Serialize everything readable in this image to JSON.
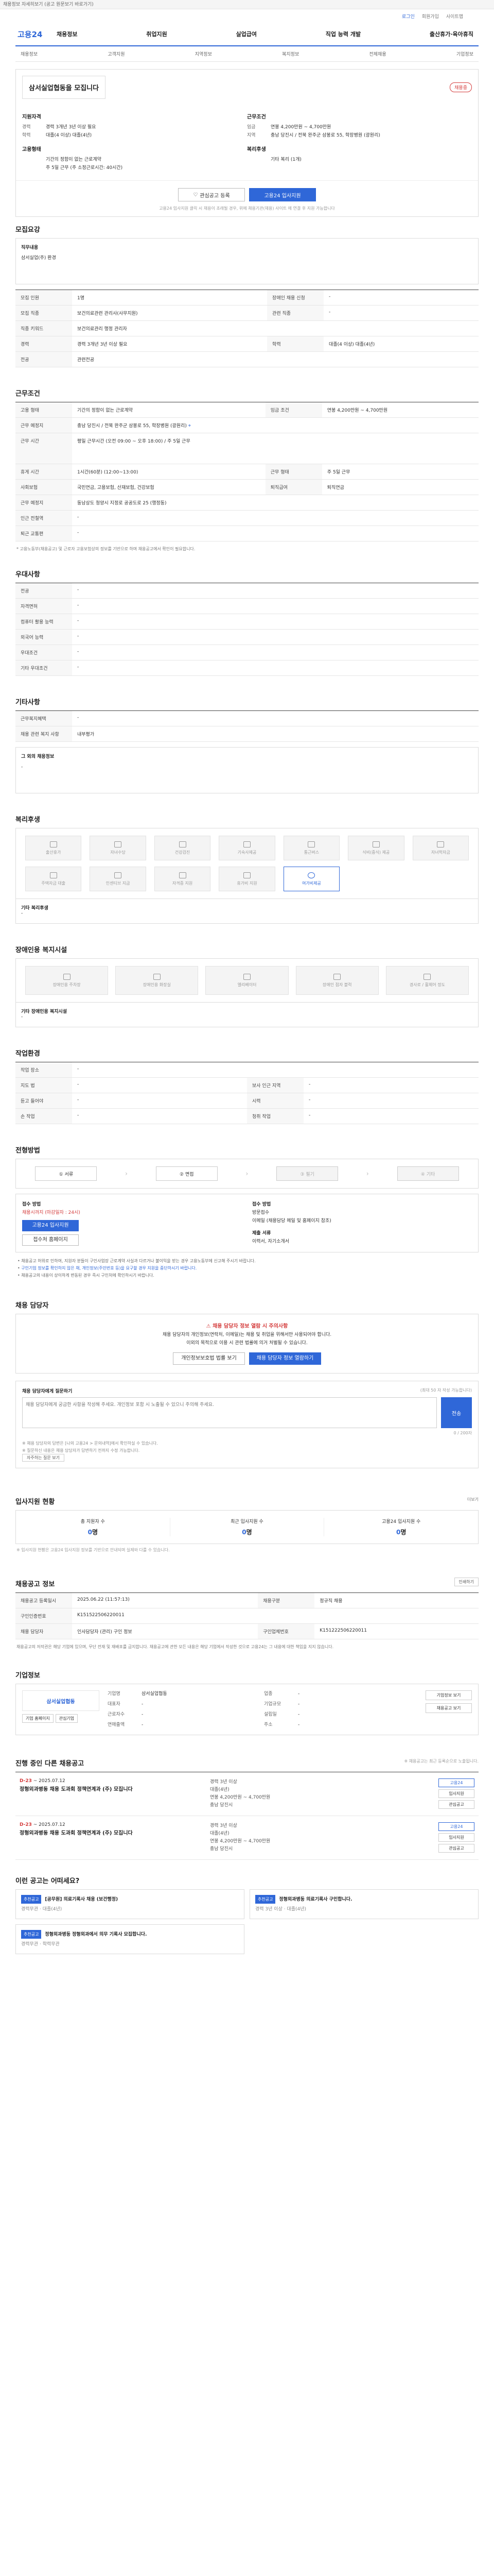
{
  "top_notice": "채용정보 자세히보기 (공고 원문보기 바로가기)",
  "util": {
    "login": "로그인",
    "join": "회원가입",
    "sitemap": "사이트맵"
  },
  "gnb": {
    "logo": "고용24",
    "menu": [
      "채용정보",
      "취업지원",
      "실업급여",
      "직업 능력 개발",
      "출산휴가·육아휴직"
    ]
  },
  "subnav": {
    "items": [
      "채용정보",
      "고객지원",
      "지역정보",
      "복지정보",
      "전체채용",
      "기업정보"
    ]
  },
  "summary": {
    "company": "삼서실업협동을 모집니다",
    "badge": "채용중",
    "left_title": "지원자격",
    "left": [
      {
        "k": "경력",
        "v": "경력 3개년 3년 이상 필요"
      },
      {
        "k": "학력",
        "v": "대졸(4 이상) 대졸(4년)"
      }
    ],
    "left2_title": "고용형태",
    "left2": [
      {
        "k": "",
        "v": "기간의 정함이 없는 근로계약"
      },
      {
        "k": "",
        "v": "주 5일 근무 (주 소정근로시간: 40시간)"
      }
    ],
    "right_title": "근무조건",
    "right": [
      {
        "k": "임금",
        "v": "연봉 4,200만원 ~ 4,700만원"
      },
      {
        "k": "지역",
        "v": "충남 당진시 / 전북 완주군 삼봉로 55, 학장병원 (광원리)"
      }
    ],
    "right2_title": "복리후생",
    "right2": [
      {
        "k": "",
        "v": "기타 복리 (1개)"
      }
    ],
    "actions": {
      "scrap": "관심공고 등록",
      "apply": "고용24 입사지원"
    },
    "note": "고용24 입사지원 클릭 시 채용이 초래될 경우, 위에 채용기관(채용) 사이트 에 연결 후 지원 가능합니다"
  },
  "recruit": {
    "title": "모집요강",
    "duty_title": "직무내용",
    "duty_text": "삼서실업(주) 환경",
    "rows": [
      {
        "k": "모집 인원",
        "v": "1명",
        "k2": "장애인 채용 신청",
        "v2": "-"
      },
      {
        "k": "모집 직종",
        "v": "보건의료관련 관리사(사무지원)",
        "k2": "관련 직종",
        "v2": "-"
      },
      {
        "k": "직종 키워드",
        "v": "보건의료관리 행정 관리자",
        "k2": "",
        "v2": ""
      },
      {
        "k": "경력",
        "v": "경력 3개년 3년 이상 필요",
        "k2": "학력",
        "v2": "대졸(4 이상) 대졸(4년)"
      },
      {
        "k": "전공",
        "v": "관련전공",
        "k2": "",
        "v2": ""
      }
    ]
  },
  "conditions": {
    "title": "근무조건",
    "rows": [
      {
        "k": "고용 형태",
        "v": "기간의 정함이 없는 근로계약",
        "k2": "임금 조건",
        "v2": "연봉 4,200만원 ~ 4,700만원"
      },
      {
        "k": "근무 예정지",
        "v": "충남 당진시 / 전북 완주군 삼봉로 55, 학장병원 (광원리)",
        "k2": "",
        "v2": ""
      },
      {
        "k": "근무 시간",
        "v": "평일 근무시간 (오전 09:00 ~ 오후 18:00) / 주 5일 근무",
        "k2": "",
        "v2": ""
      },
      {
        "k": "휴게 시간",
        "v": "1시간(60분) (12:00~13:00)",
        "k2": "근무 형태",
        "v2": "주 5일 근무"
      },
      {
        "k": "사회보험",
        "v": "국민연금, 고용보험, 산재보험, 건강보험",
        "k2": "퇴직급여",
        "v2": "퇴직연금"
      },
      {
        "k": "근무 예정지",
        "v": "동남상도 청양시 지정로 공공도로 25 (행정동)",
        "k2": "",
        "v2": ""
      },
      {
        "k": "인근 전철역",
        "v": "-",
        "k2": "",
        "v2": ""
      },
      {
        "k": "퇴근 교통편",
        "v": "-",
        "k2": "",
        "v2": ""
      }
    ],
    "note": "* 고용노동부(채용공고) 및 근로자 고용보험상의 정보를 기반으로 하며 채용공고에서 확인이 필요합니다."
  },
  "prefer": {
    "title": "우대사항",
    "rows": [
      {
        "k": "전공",
        "v": "-"
      },
      {
        "k": "자격면허",
        "v": "-"
      },
      {
        "k": "컴퓨터 활용 능력",
        "v": "-"
      },
      {
        "k": "외국어 능력",
        "v": "-"
      },
      {
        "k": "우대조건",
        "v": "-"
      },
      {
        "k": "기타 우대조건",
        "v": "-"
      }
    ]
  },
  "etc": {
    "title": "기타사항",
    "rows": [
      {
        "k": "근무복지혜택",
        "v": "-"
      },
      {
        "k": "채용 관련 복지 사항",
        "v": "내부평가"
      }
    ],
    "text_title": "그 외의 채용정보",
    "text": "-"
  },
  "welfare": {
    "title": "복리후생",
    "items": [
      {
        "name": "출산휴가",
        "on": false
      },
      {
        "name": "자녀수당",
        "on": false
      },
      {
        "name": "건강검진",
        "on": false
      },
      {
        "name": "기숙사제공",
        "on": false
      },
      {
        "name": "통근버스",
        "on": false
      },
      {
        "name": "식비(중식) 제공",
        "on": false
      },
      {
        "name": "자녀학자금",
        "on": false
      },
      {
        "name": "주택자금 대출",
        "on": false
      },
      {
        "name": "인센티브 지급",
        "on": false
      },
      {
        "name": "자격증 지원",
        "on": false
      },
      {
        "name": "휴가비 지원",
        "on": false
      },
      {
        "name": "여가비제공",
        "on": true
      }
    ],
    "other_title": "기타 복리후생",
    "other": "-"
  },
  "disabled": {
    "title": "장애인용 복지시설",
    "items": [
      {
        "name": "장애인용 주차장",
        "on": false
      },
      {
        "name": "장애인용 화장실",
        "on": false
      },
      {
        "name": "엘리베이터",
        "on": false
      },
      {
        "name": "장애인 점자 블럭",
        "on": false
      },
      {
        "name": "경사로 / 휠체어 정도",
        "on": false
      }
    ],
    "other_title": "기타 장애인용 복지시설",
    "other": "-"
  },
  "contest": {
    "title": "작업환경",
    "rows": [
      {
        "k": "작업 장소",
        "v": "-",
        "k2": "",
        "v2": ""
      },
      {
        "k": "지도 법",
        "v": "-",
        "k2": "보사 인근 지역",
        "v2": "-"
      },
      {
        "k": "듣고 들어야",
        "v": "-",
        "k2": "시력",
        "v2": "-"
      },
      {
        "k": "손 작업",
        "v": "-",
        "k2": "청취 작업",
        "v2": "-"
      }
    ]
  },
  "process": {
    "title": "전형방법",
    "steps": [
      {
        "name": "① 서류",
        "on": true
      },
      {
        "name": "② 면접",
        "on": true
      },
      {
        "name": "③ 필기",
        "on": false
      },
      {
        "name": "④ 기타",
        "on": false
      }
    ]
  },
  "apply": {
    "title": "접수 방법",
    "deadline_label": "채용시까지 (마감일자 : 24시)",
    "btn_apply": "고용24 입사지원",
    "btn_homepage": "접수처 홈페이지",
    "submit_title": "접수 방법",
    "submit": [
      "방문접수",
      "이메일 (채용담당 메일 및 홈페이지 참조)"
    ],
    "docs_title": "제출 서류",
    "docs": "이력서, 자기소개서"
  },
  "notices": [
    "채용공고 허위로 인하여, 지원자 분들이 구인사업장 근로계약 사실과 다르거나 불이익을 받는 경우 고용노동부에 신고해 주시기 바랍니다.",
    "구인기업 정보를 확인하지 않은 채, 개인정보(주민번호 등)을 요구할 경우 지원을 중단하시기 바랍니다.",
    "채용공고의 내용이 상이하게 변동된 경우 즉시 구인처에 확인하시기 바랍니다."
  ],
  "manager": {
    "title": "채용 담당자",
    "warn": "채용 담당자 정보 열람 시 주의사항",
    "text1": "채용 담당자의 개인정보(연락처, 이메일)는 채용 및 취업을 위해서만 사용되어야 합니다.",
    "text2": "이외의 목적으로 이용 시 관련 법률에 의거 처벌될 수 있습니다.",
    "btn_policy": "개인정보보호법 법률 보기",
    "btn_view": "채용 담당자 정보 열람하기"
  },
  "inquiry": {
    "title": "채용 담당자에게 질문하기",
    "limit_note": "(최대 50 자 작성 가능합니다)",
    "placeholder": "채용 담당자에게 궁금한 사항을 작성해 주세요. 개인정보 포함 시 노출될 수 있으니 주의해 주세요.",
    "send": "전송",
    "counter": "0 / 200자",
    "hints": [
      "※ 채용 담당자의 답변은 [나의 고용24 > 문의내역]에서 확인하실 수 있습니다.",
      "※ 질문하신 내용은 채용 담당자가 답변하기 전까지 수정 가능합니다."
    ],
    "faq_btn": "자주하는 질문 보기"
  },
  "stats": {
    "title": "입사지원 현황",
    "more": "더보기",
    "items": [
      {
        "label": "총 지원자 수",
        "num": "0",
        "unit": "명"
      },
      {
        "label": "최근 입사지원 수",
        "num": "0",
        "unit": "명"
      },
      {
        "label": "고용24 입사지원 수",
        "num": "0",
        "unit": "명"
      }
    ],
    "note": "※ 입사지원 현황은 고용24 입사지원 정보를 기반으로 안내되며 실제와 다를 수 있습니다."
  },
  "posting_info": {
    "title": "채용공고 정보",
    "btn": "인쇄하기",
    "rows": [
      {
        "k": "채용공고 등록일시",
        "v": "2025.06.22 (11:57:13)",
        "k2": "채용구분",
        "v2": "정규직 채용"
      },
      {
        "k": "구인인증번호",
        "v": "K151522506220011",
        "k2": "",
        "v2": ""
      },
      {
        "k": "채용 담당자",
        "v": "인사담당자 (관리) 구인 정보",
        "k2": "구인업체번호",
        "v2": "K151222506220011"
      }
    ],
    "copy_note": "채용공고의 저작권은 해당 기업에 있으며, 무단 전재 및 재배포를 금지합니다. 채용공고에 관한 모든 내용은 해당 기업에서 작성한 것으로 고용24는 그 내용에 대한 책임을 지지 않습니다."
  },
  "company": {
    "title": "기업정보",
    "logo_text": "삼서실업협동",
    "btns": [
      "기업 홈페이지",
      "관심기업"
    ],
    "rows": [
      {
        "k": "기업명",
        "v": "삼서실업협동",
        "k2": "업종",
        "v2": "-"
      },
      {
        "k": "대표자",
        "v": "-",
        "k2": "기업규모",
        "v2": "-"
      },
      {
        "k": "근로자수",
        "v": "-",
        "k2": "설립일",
        "v2": "-"
      },
      {
        "k": "연매출액",
        "v": "-",
        "k2": "주소",
        "v2": "-"
      }
    ],
    "side": [
      "기업정보 보기",
      "채용공고 보기"
    ]
  },
  "others": {
    "title": "진행 중인 다른 채용공고",
    "note": "※ 채용공고는 최근 등록순으로 노출됩니다.",
    "posts": [
      {
        "dday": "D-23",
        "date": "~ 2025.07.12",
        "title": "정형외과병동 채용 도과회 정책연계과 (주) 모집니다",
        "meta": [
          "경력 3년 이상",
          "대졸(4년)",
          "연봉 4,200만원 ~ 4,700만원",
          "충남 당진시"
        ],
        "tags": [
          "고용24",
          "입사지원",
          "관심공고"
        ]
      },
      {
        "dday": "D-23",
        "date": "~ 2025.07.12",
        "title": "정형외과병동 채용 도과회 정책연계과 (주) 모집니다",
        "meta": [
          "경력 3년 이상",
          "대졸(4년)",
          "연봉 4,200만원 ~ 4,700만원",
          "충남 당진시"
        ],
        "tags": [
          "고용24",
          "입사지원",
          "관심공고"
        ]
      }
    ]
  },
  "reco": {
    "title": "이런 공고는 어떠세요?",
    "items": [
      {
        "tag": "추천공고",
        "title": "[공무원] 의료기록사 채용 (보건행정)",
        "meta": "경력무관 · 대졸(4년)"
      },
      {
        "tag": "추천공고",
        "title": "정형외과병동 의료기록사 구인합니다.",
        "meta": "경력 3년 이상 · 대졸(4년)"
      },
      {
        "tag": "추천공고",
        "title": "정형외과병동 정형외과에서 의무 기록사 모집합니다.",
        "meta": "경력무관 · 학력무관"
      }
    ]
  }
}
